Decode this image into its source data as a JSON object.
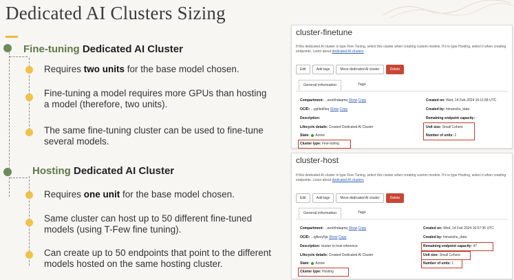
{
  "slide": {
    "title": "Dedicated AI Clusters Sizing",
    "finetuning_section": {
      "label_green": "Fine-tuning",
      "label_rest": " Dedicated AI Cluster",
      "bullets": [
        {
          "pre": "Requires ",
          "bold": "two units",
          "post": " for the base model chosen."
        },
        {
          "pre": "Fine-tuning a model requires more GPUs than hosting a model (therefore, two units).",
          "bold": "",
          "post": ""
        },
        {
          "pre": "The same fine-tuning cluster can be used to fine-tune several models.",
          "bold": "",
          "post": ""
        }
      ]
    },
    "hosting_section": {
      "label_green": "Hosting",
      "label_rest": " Dedicated AI Cluster",
      "bullets": [
        {
          "pre": "Requires ",
          "bold": "one unit",
          "post": " for the base model chosen."
        },
        {
          "pre": "Same cluster can host up to 50 different fine-tuned models (using T-Few fine tuning).",
          "bold": "",
          "post": ""
        },
        {
          "pre": "Can create up to 50 endpoints that point to the different models hosted on the same hosting cluster.",
          "bold": "",
          "post": ""
        }
      ]
    }
  },
  "cluster_finetune": {
    "title": "cluster-finetune",
    "desc": "If this dedicated AI cluster is type Fine-Tuning, select this cluster when creating custom models. If it is type Hosting, select it when creating endpoints. Learn about ",
    "desc_link": "dedicated AI clusters",
    "buttons": [
      "Edit",
      "Add tags",
      "Move dedicated AI cluster",
      "Delete"
    ],
    "tabs": [
      "General information",
      "Tags"
    ],
    "compartment_label": "Compartment:",
    "compartment_value": "...wzshhdaqmq",
    "show": "Show",
    "copy": "Copy",
    "ocid_label": "OCID:",
    "ocid_value": "...yghlekftzq",
    "description_label": "Description:",
    "lifecycle_label": "Lifecycle details:",
    "lifecycle_value": "Created Dedicated AI Cluster",
    "state_label": "State:",
    "state_value": "Active",
    "cluster_type_label": "Cluster type:",
    "cluster_type_value": "Fine-tuning",
    "created_on_label": "Created on:",
    "created_on_value": "Wed, 14 Feb 2024 16:11:58 UTC",
    "created_by_label": "Created by:",
    "created_by_value": "himanshu_data",
    "remaining_label": "Remaining endpoint capacity:",
    "remaining_value": "-",
    "unit_size_label": "Unit size:",
    "unit_size_value": "Small Cohere",
    "units_label": "Number of units:",
    "units_value": "2"
  },
  "cluster_host": {
    "title": "cluster-host",
    "desc": "If this dedicated AI cluster is type Fine-Tuning, select this cluster when creating custom models. If it is type Hosting, select it when creating endpoints. Learn about ",
    "desc_link": "dedicated AI clusters",
    "buttons": [
      "Edit",
      "Add tags",
      "Move dedicated AI cluster",
      "Delete"
    ],
    "tabs": [
      "General information",
      "Tags"
    ],
    "compartment_label": "Compartment:",
    "compartment_value": "...wzshhdaqmq",
    "show": "Show",
    "copy": "Copy",
    "ocid_label": "OCID:",
    "ocid_value": "...igftzzy5ja",
    "description_label": "Description:",
    "description_value": "cluster to host inference",
    "lifecycle_label": "Lifecycle details:",
    "lifecycle_value": "Created Dedicated AI Cluster",
    "state_label": "State:",
    "state_value": "Active",
    "cluster_type_label": "Cluster type:",
    "cluster_type_value": "Hosting",
    "created_on_label": "Created on:",
    "created_on_value": "Wed, 14 Feb 2024 16:57:35 UTC",
    "created_by_label": "Created by:",
    "created_by_value": "himanshu_data",
    "remaining_label": "Remaining endpoint capacity:",
    "remaining_value": "47",
    "unit_size_label": "Unit size:",
    "unit_size_value": "Small Cohere",
    "units_label": "Number of units:",
    "units_value": "1"
  },
  "colors": {
    "accent_green": "#5b7a45",
    "bullet_yellow": "#f0c24a",
    "highlight_red": "#c23b2b",
    "delete_red": "#c74634"
  }
}
